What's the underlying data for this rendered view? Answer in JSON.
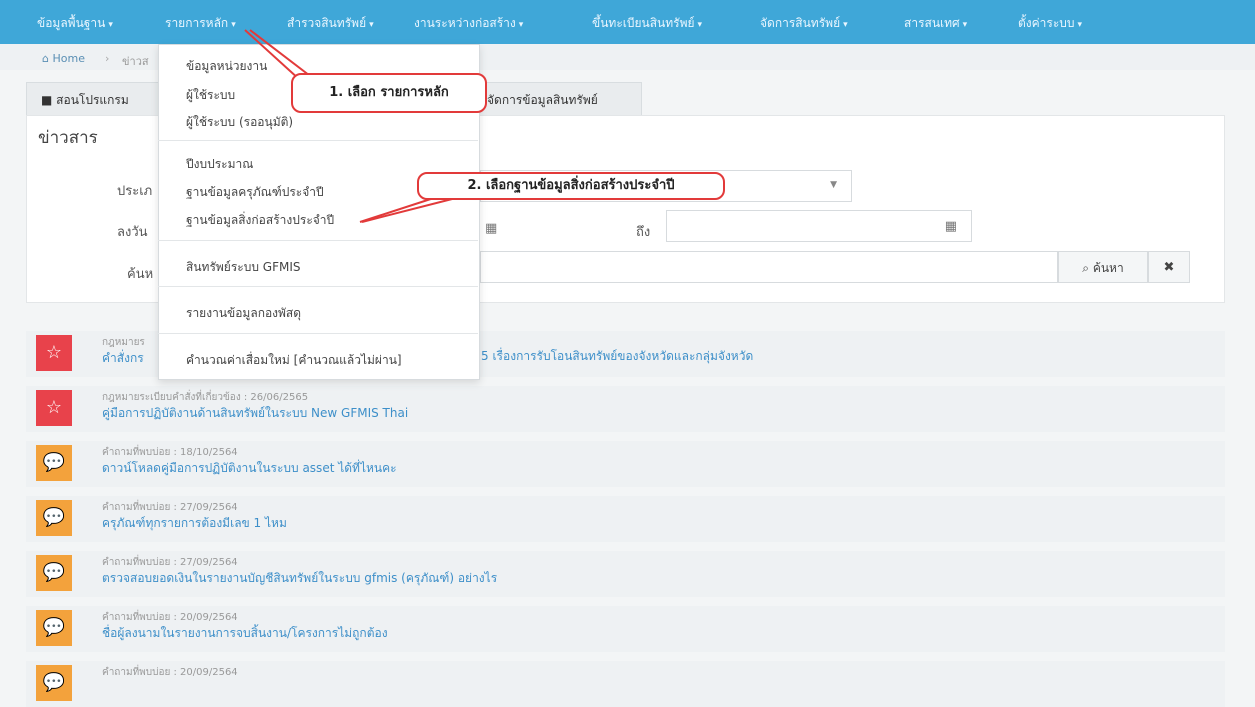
{
  "nav": {
    "items": [
      {
        "label": "ข้อมูลพื้นฐาน"
      },
      {
        "label": "รายการหลัก"
      },
      {
        "label": "สำรวจสินทรัพย์"
      },
      {
        "label": "งานระหว่างก่อสร้าง"
      },
      {
        "label": "ขึ้นทะเบียนสินทรัพย์"
      },
      {
        "label": "จัดการสินทรัพย์"
      },
      {
        "label": "สารสนเทศ"
      },
      {
        "label": "ตั้งค่าระบบ"
      }
    ]
  },
  "breadcrumb": {
    "home": "Home",
    "current": "ข่าวส"
  },
  "tabs": {
    "manual": "สอนโปรแกรม",
    "asset": "จัดการข้อมูลสินทรัพย์"
  },
  "panel": {
    "title": "ข่าวสาร",
    "type_label": "ประเภ",
    "date_label": "ลงวัน",
    "search_label": "ค้นห",
    "to_label": "ถึง",
    "search_button": "ค้นหา",
    "clear_button": "✖"
  },
  "dropdown": {
    "items": [
      "ข้อมูลหน่วยงาน",
      "ผู้ใช้ระบบ",
      "ผู้ใช้ระบบ (รออนุมัติ)",
      "ปีงบประมาณ",
      "ฐานข้อมูลครุภัณฑ์ประจำปี",
      "ฐานข้อมูลสิ่งก่อสร้างประจำปี",
      "สินทรัพย์ระบบ GFMIS",
      "รายงานข้อมูลกองพัสดุ",
      "คำนวณค่าเสื่อมใหม่ [คำนวณแล้วไม่ผ่าน]"
    ]
  },
  "annotations": {
    "step1": "1. เลือก รายการหลัก",
    "step2": "2. เลือกฐานข้อมูลสิ่งก่อสร้างประจำปี"
  },
  "news": [
    {
      "meta": "กฎหมายร",
      "title": "คำสั่งกร",
      "tail": "5 เรื่องการรับโอนสินทรัพย์ของจังหวัดและกลุ่มจังหวัด",
      "icon": "star-icon",
      "color": "#e8424b"
    },
    {
      "meta": "กฎหมายระเบียบคำสั่งที่เกี่ยวข้อง : 26/06/2565",
      "title": "คู่มือการปฏิบัติงานด้านสินทรัพย์ในระบบ New GFMIS Thai",
      "icon": "star-icon",
      "color": "#e8424b"
    },
    {
      "meta": "คำถามที่พบบ่อย : 18/10/2564",
      "title": "ดาวน์โหลดคู่มือการปฏิบัติงานในระบบ asset ได้ที่ไหนคะ",
      "icon": "comment-icon",
      "color": "#f3a23c"
    },
    {
      "meta": "คำถามที่พบบ่อย : 27/09/2564",
      "title": "ครุภัณฑ์ทุกรายการต้องมีเลข 1 ไหม",
      "icon": "comment-icon",
      "color": "#f3a23c"
    },
    {
      "meta": "คำถามที่พบบ่อย : 27/09/2564",
      "title": "ตรวจสอบยอดเงินในรายงานบัญชีสินทรัพย์ในระบบ gfmis (ครุภัณฑ์) อย่างไร",
      "icon": "comment-icon",
      "color": "#f3a23c"
    },
    {
      "meta": "คำถามที่พบบ่อย : 20/09/2564",
      "title": "ชื่อผู้ลงนามในรายงานการจบสิ้นงาน/โครงการไม่ถูกต้อง",
      "icon": "comment-icon",
      "color": "#f3a23c"
    },
    {
      "meta": "คำถามที่พบบ่อย : 20/09/2564",
      "title": "",
      "icon": "comment-icon",
      "color": "#f3a23c"
    }
  ]
}
